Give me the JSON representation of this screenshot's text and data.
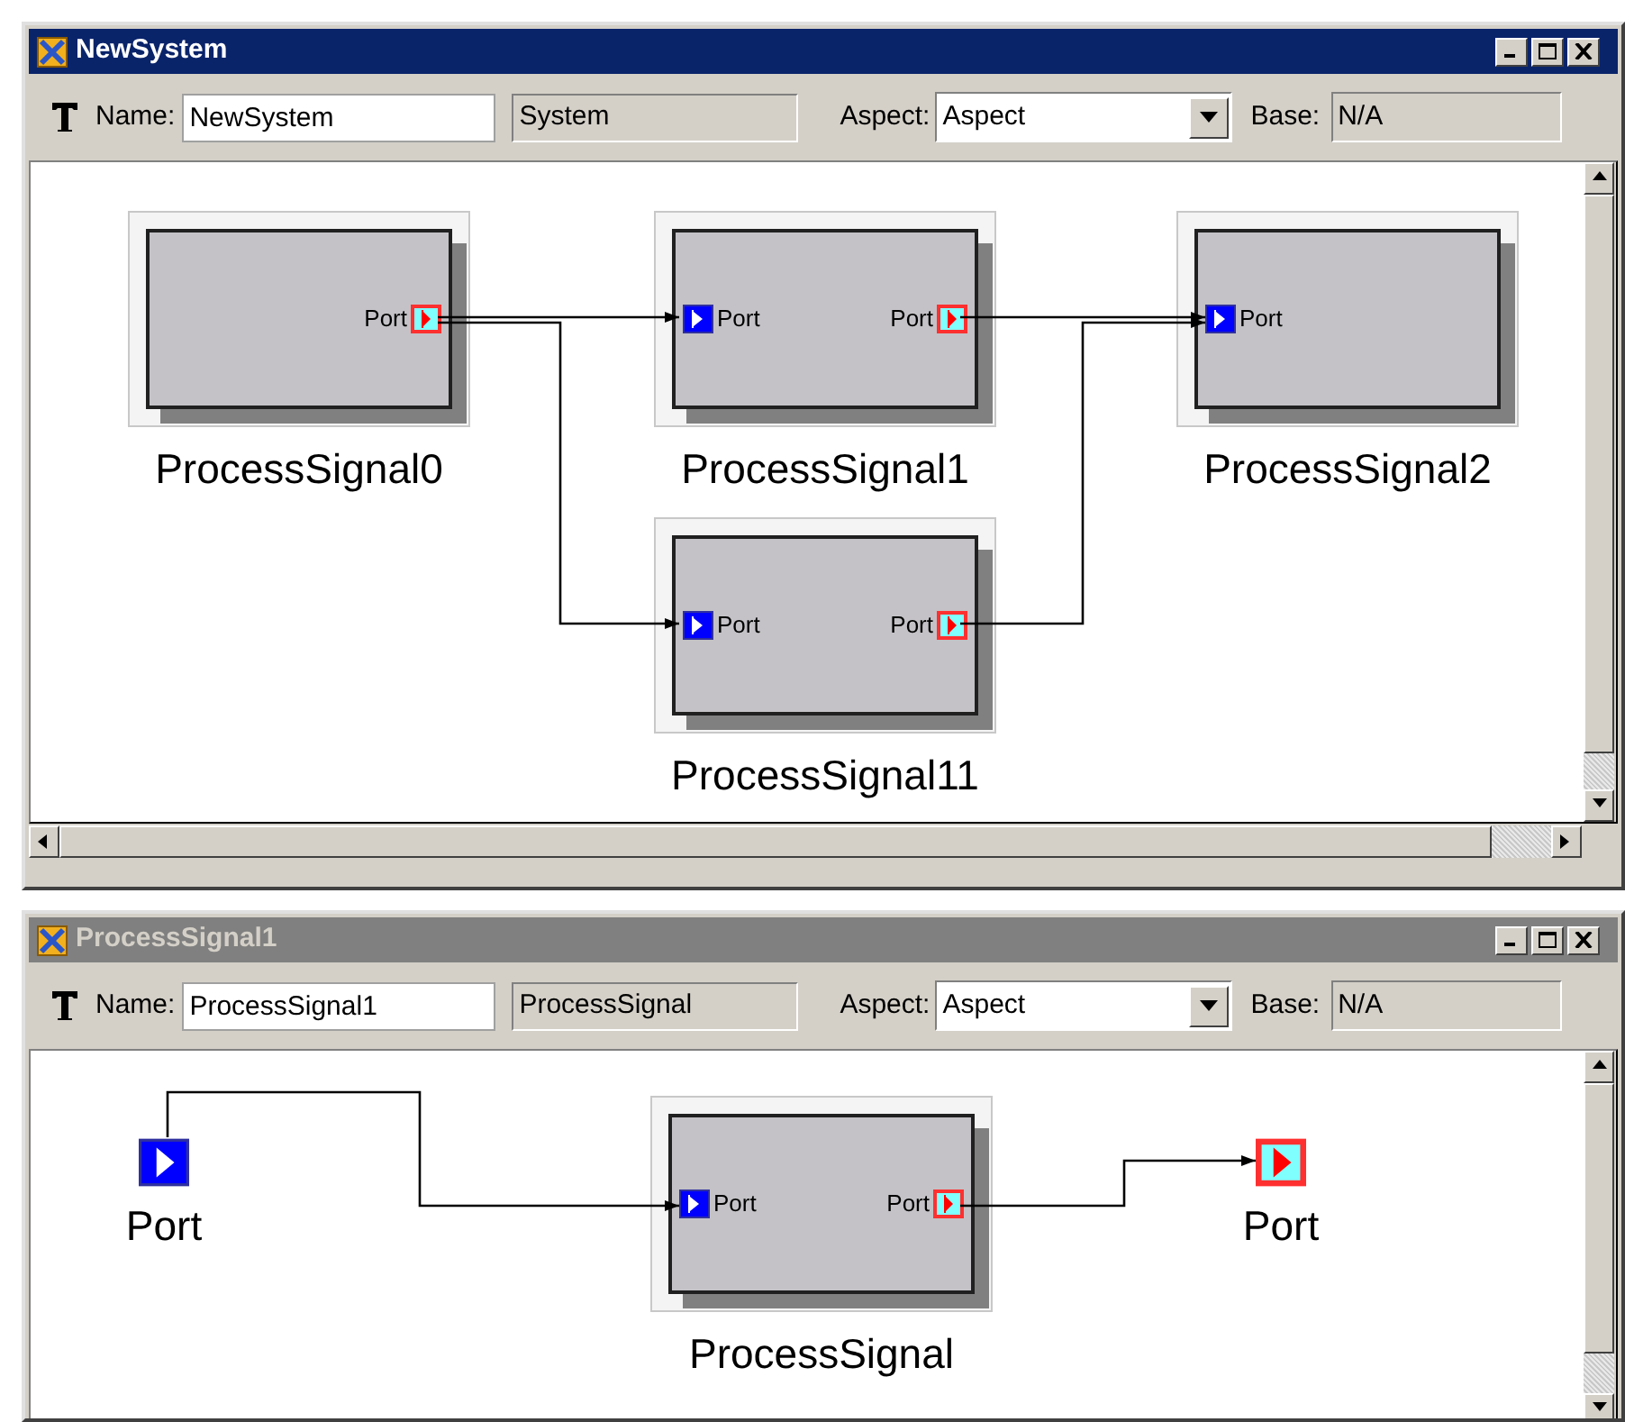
{
  "windows": [
    {
      "title": "NewSystem",
      "active": true,
      "toolbar": {
        "name_label": "Name:",
        "name_value": "NewSystem",
        "type_value": "System",
        "aspect_label": "Aspect:",
        "aspect_value": "Aspect",
        "base_label": "Base:",
        "base_value": "N/A"
      },
      "diagram": [
        {
          "kind": "model",
          "label": "ProcessSignal0",
          "ports": [
            {
              "kind": "out",
              "label": "Port"
            }
          ]
        },
        {
          "kind": "model",
          "label": "ProcessSignal1",
          "ports": [
            {
              "kind": "in",
              "label": "Port"
            },
            {
              "kind": "out",
              "label": "Port"
            }
          ]
        },
        {
          "kind": "model",
          "label": "ProcessSignal2",
          "ports": [
            {
              "kind": "in",
              "label": "Port"
            }
          ]
        },
        {
          "kind": "model",
          "label": "ProcessSignal11",
          "ports": [
            {
              "kind": "in",
              "label": "Port"
            },
            {
              "kind": "out",
              "label": "Port"
            }
          ]
        }
      ]
    },
    {
      "title": "ProcessSignal1",
      "active": false,
      "toolbar": {
        "name_label": "Name:",
        "name_value": "ProcessSignal1",
        "type_value": "ProcessSignal",
        "aspect_label": "Aspect:",
        "aspect_value": "Aspect",
        "base_label": "Base:",
        "base_value": "N/A"
      },
      "diagram": [
        {
          "kind": "in",
          "label": "Port"
        },
        {
          "kind": "model",
          "label": "ProcessSignal",
          "ports": [
            {
              "kind": "in",
              "label": "Port"
            },
            {
              "kind": "out",
              "label": "Port"
            }
          ]
        },
        {
          "kind": "out",
          "label": "Port"
        }
      ]
    }
  ]
}
